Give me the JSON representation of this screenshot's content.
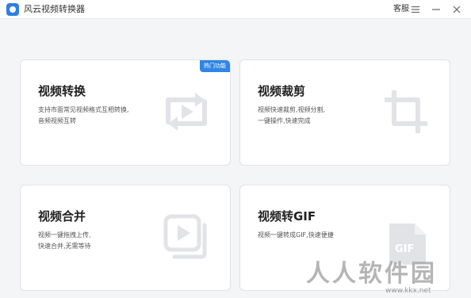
{
  "titlebar": {
    "app_title": "风云视频转换器",
    "service_label": "客服",
    "menu_icon": "menu-icon",
    "minimize_icon": "minimize-icon",
    "close_icon": "close-icon"
  },
  "cards": [
    {
      "title": "视频转换",
      "desc_lines": [
        "支持市面常见视频格式互相转换,",
        "音频视频互转"
      ],
      "badge": "热门功能",
      "icon": "convert-icon"
    },
    {
      "title": "视频裁剪",
      "desc_lines": [
        "视频快速裁剪,视频分割,",
        "一键操作,快速完成"
      ],
      "icon": "crop-icon"
    },
    {
      "title": "视频合并",
      "desc_lines": [
        "视频一键拖拽上传,",
        "快速合并,无需等待"
      ],
      "icon": "merge-icon"
    },
    {
      "title": "视频转GIF",
      "desc_lines": [
        "视频一键转成GIF,快速便捷"
      ],
      "icon": "gif-icon",
      "icon_text": "GIF"
    }
  ],
  "watermark": {
    "big": "人人软件园",
    "small": "www.kkx.net"
  },
  "colors": {
    "accent": "#2f86e6",
    "icon_gray": "#e2e3e6",
    "background": "#f4f5f7"
  }
}
